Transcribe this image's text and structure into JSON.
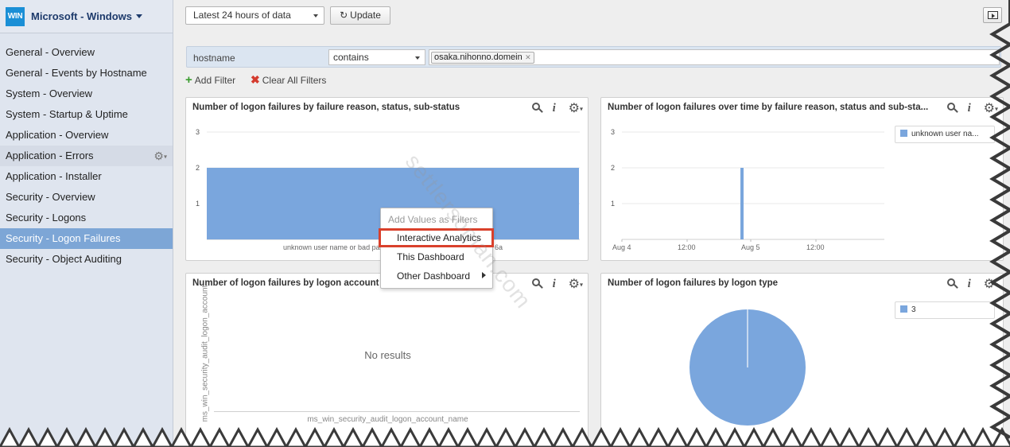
{
  "app": {
    "logo_text": "WIN",
    "title": "Microsoft - Windows"
  },
  "sidebar": {
    "items": [
      {
        "label": "General - Overview"
      },
      {
        "label": "General - Events by Hostname"
      },
      {
        "label": "System - Overview"
      },
      {
        "label": "System - Startup & Uptime"
      },
      {
        "label": "Application - Overview"
      },
      {
        "label": "Application - Errors",
        "state": "hover"
      },
      {
        "label": "Application - Installer"
      },
      {
        "label": "Security - Overview"
      },
      {
        "label": "Security - Logons"
      },
      {
        "label": "Security - Logon Failures",
        "state": "active"
      },
      {
        "label": "Security - Object Auditing"
      }
    ],
    "active_index": 9,
    "hover_index": 5,
    "active_color": "#7da6d6"
  },
  "toolbar": {
    "time_range": "Latest 24 hours of data",
    "update_label": "Update"
  },
  "filter": {
    "field": "hostname",
    "operator": "contains",
    "value": "osaka.nihonno.domein",
    "add_label": "Add Filter",
    "clear_label": "Clear All Filters"
  },
  "panels": {
    "p1": {
      "title": "Number of logon failures by failure reason, status, sub-status",
      "y_ticks": [
        "3",
        "2",
        "1"
      ],
      "x_label_left": "unknown user name or bad pa",
      "x_label_right": "6a"
    },
    "p2": {
      "title": "Number of logon failures over time by failure reason, status and sub-sta...",
      "y_ticks": [
        "3",
        "2",
        "1"
      ],
      "x_ticks": [
        "Aug 4",
        "12:00",
        "Aug 5",
        "12:00"
      ],
      "legend": "unknown user na..."
    },
    "p3": {
      "title": "Number of logon failures by logon account",
      "no_results": "No results",
      "y_axis_label": "ms_win_security_audit_logon_account",
      "x_axis_label": "ms_win_security_audit_logon_account_name"
    },
    "p4": {
      "title": "Number of logon failures by logon type",
      "legend": "3"
    }
  },
  "context_menu": {
    "header": "Add Values as Filters",
    "items": [
      {
        "label": "Interactive Analytics",
        "highlighted": true
      },
      {
        "label": "This Dashboard"
      },
      {
        "label": "Other Dashboard"
      }
    ]
  },
  "icons": {
    "panel_tools": [
      "search-icon",
      "info-icon",
      "gear-icon"
    ],
    "toolbar": [
      "refresh-icon",
      "fullscreen-icon"
    ],
    "filter": [
      "plus-icon",
      "close-icon"
    ]
  },
  "colors": {
    "series": "#7aa6dd",
    "highlight_border": "#d9402b",
    "logo_bg": "#1a8fd6"
  },
  "watermark": "settlersoman.com",
  "chart_data": [
    {
      "type": "bar",
      "title": "Number of logon failures by failure reason, status, sub-status",
      "categories": [
        "unknown user name or bad pa…6a"
      ],
      "values": [
        2
      ],
      "ylim": [
        0,
        3
      ]
    },
    {
      "type": "bar",
      "title": "Number of logon failures over time by failure reason, status and sub-sta...",
      "x": [
        "Aug 5 ~00:00"
      ],
      "values": [
        2
      ],
      "ylim": [
        0,
        3
      ],
      "x_ticks": [
        "Aug 4",
        "12:00",
        "Aug 5",
        "12:00"
      ],
      "legend": [
        "unknown user na..."
      ]
    },
    {
      "type": "pie",
      "title": "Number of logon failures by logon type",
      "categories": [
        "3"
      ],
      "values": [
        100
      ]
    }
  ]
}
